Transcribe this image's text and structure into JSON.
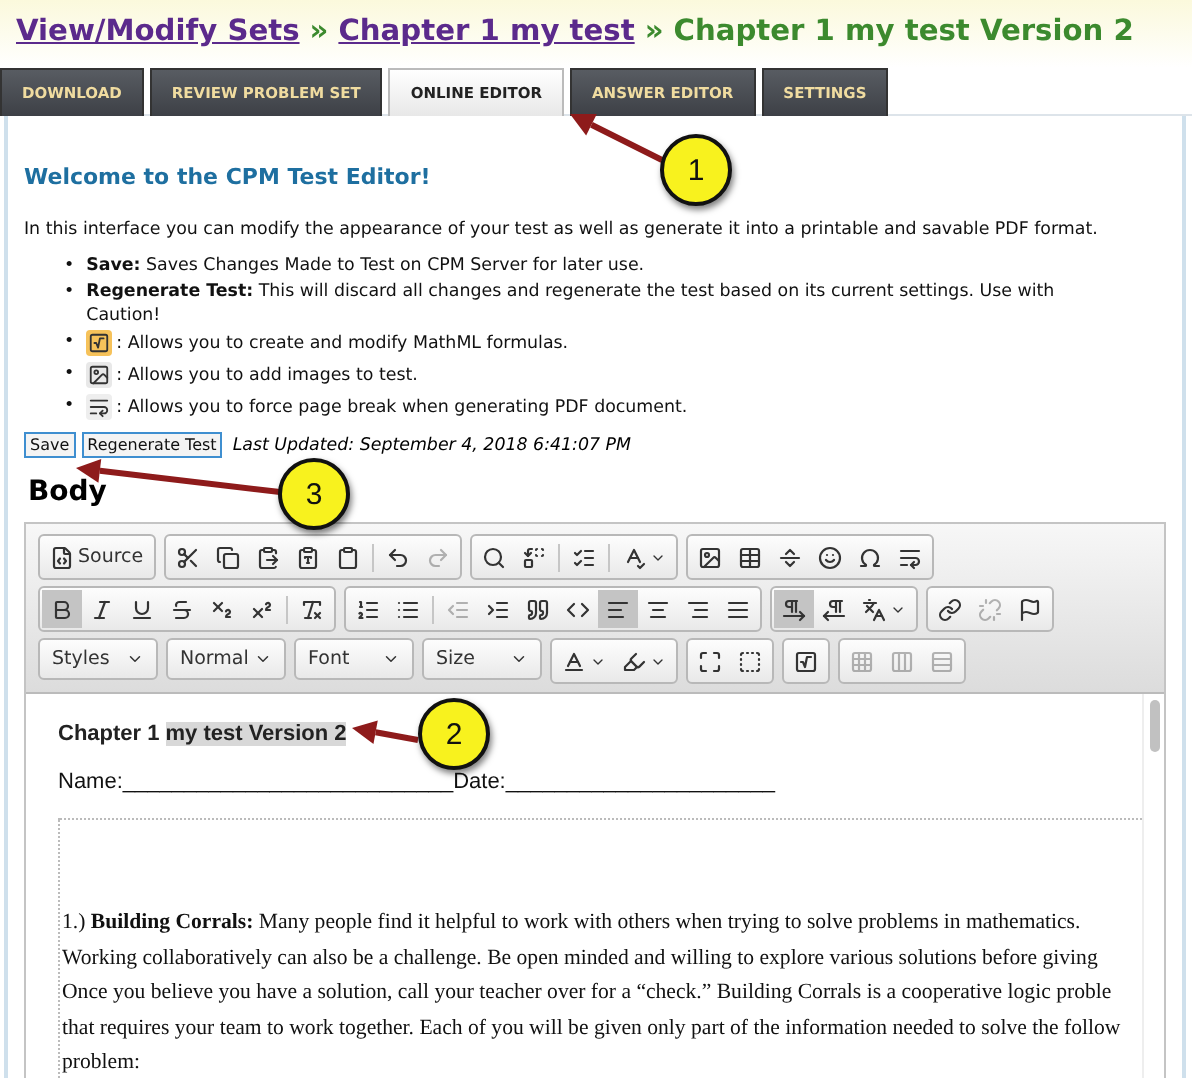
{
  "breadcrumb": [
    {
      "text": "View/Modify Sets",
      "kind": "link"
    },
    {
      "text": "»",
      "kind": "separator"
    },
    {
      "text": "Chapter 1 my test",
      "kind": "link"
    },
    {
      "text": "»",
      "kind": "separator"
    },
    {
      "text": "Chapter 1 my test Version 2",
      "kind": "current"
    }
  ],
  "tabs": [
    {
      "label": "DOWNLOAD",
      "selected": false
    },
    {
      "label": "REVIEW PROBLEM SET",
      "selected": false
    },
    {
      "label": "ONLINE EDITOR",
      "selected": true
    },
    {
      "label": "ANSWER EDITOR",
      "selected": false
    },
    {
      "label": "SETTINGS",
      "selected": false
    }
  ],
  "welcome": "Welcome to the CPM Test Editor!",
  "intro": "In this interface you can modify the appearance of your test as well as generate it into a printable and savable PDF format.",
  "bullets": [
    {
      "kind": "text",
      "marker": "•",
      "text": "**Save:** Saves Changes Made to Test on CPM Server for later use."
    },
    {
      "kind": "text",
      "marker": "•",
      "text": "**Regenerate Test:** This will discard all changes and regenerate the test based on its current settings. Use with Caution!"
    },
    {
      "kind": "formula",
      "marker": "•",
      "text": ": Allows you to create and modify MathML formulas."
    },
    {
      "kind": "image",
      "marker": "•",
      "text": ": Allows you to add images to test."
    },
    {
      "kind": "pagebreak",
      "marker": "•",
      "text": ": Allows you to force page break when generating PDF document."
    }
  ],
  "buttons": [
    "Save",
    "Regenerate Test"
  ],
  "last_updated": "Last Updated: September 4, 2018 6:41:07 PM",
  "body_heading": "Body",
  "toolbar": [
    [
      [
        {
          "kind": "button",
          "label": "Source",
          "active": false,
          "disabled": false
        }
      ],
      [
        {
          "kind": "button",
          "active": false,
          "disabled": false
        },
        {
          "kind": "button",
          "active": false,
          "disabled": false
        },
        {
          "kind": "button",
          "active": false,
          "disabled": false
        },
        {
          "kind": "button",
          "active": false,
          "disabled": false
        },
        {
          "kind": "button",
          "active": false,
          "disabled": false
        },
        {
          "kind": "separator"
        },
        {
          "kind": "button",
          "active": false,
          "disabled": false
        },
        {
          "kind": "button",
          "active": false,
          "disabled": true
        }
      ],
      [
        {
          "kind": "button",
          "active": false,
          "disabled": false
        },
        {
          "kind": "button",
          "active": false,
          "disabled": false
        },
        {
          "kind": "separator"
        },
        {
          "kind": "button",
          "active": false,
          "disabled": false
        },
        {
          "kind": "separator"
        },
        {
          "kind": "menu",
          "active": false,
          "disabled": false
        }
      ],
      [
        {
          "kind": "button",
          "active": false,
          "disabled": false
        },
        {
          "kind": "button",
          "active": false,
          "disabled": false
        },
        {
          "kind": "button",
          "active": false,
          "disabled": false
        },
        {
          "kind": "button",
          "active": false,
          "disabled": false
        },
        {
          "kind": "button",
          "active": false,
          "disabled": false
        },
        {
          "kind": "button",
          "active": false,
          "disabled": false
        }
      ]
    ],
    [
      [
        {
          "kind": "button",
          "active": true,
          "disabled": false
        },
        {
          "kind": "button",
          "active": false,
          "disabled": false
        },
        {
          "kind": "button",
          "active": false,
          "disabled": false
        },
        {
          "kind": "button",
          "active": false,
          "disabled": false
        },
        {
          "kind": "button",
          "active": false,
          "disabled": false
        },
        {
          "kind": "button",
          "active": false,
          "disabled": false
        },
        {
          "kind": "separator"
        },
        {
          "kind": "button",
          "active": false,
          "disabled": false
        }
      ],
      [
        {
          "kind": "button",
          "active": false,
          "disabled": false
        },
        {
          "kind": "button",
          "active": false,
          "disabled": false
        },
        {
          "kind": "separator"
        },
        {
          "kind": "button",
          "active": false,
          "disabled": true
        },
        {
          "kind": "button",
          "active": false,
          "disabled": false
        },
        {
          "kind": "button",
          "active": false,
          "disabled": false
        },
        {
          "kind": "button",
          "active": false,
          "disabled": false
        },
        {
          "kind": "button",
          "active": true,
          "disabled": false
        },
        {
          "kind": "button",
          "active": false,
          "disabled": false
        },
        {
          "kind": "button",
          "active": false,
          "disabled": false
        },
        {
          "kind": "button",
          "active": false,
          "disabled": false
        }
      ],
      [
        {
          "kind": "button",
          "active": true,
          "disabled": false
        },
        {
          "kind": "button",
          "active": false,
          "disabled": false
        },
        {
          "kind": "menu",
          "active": false,
          "disabled": false
        }
      ],
      [
        {
          "kind": "button",
          "active": false,
          "disabled": false
        },
        {
          "kind": "button",
          "active": false,
          "disabled": true
        },
        {
          "kind": "button",
          "active": false,
          "disabled": false
        }
      ]
    ],
    [
      [
        {
          "kind": "dropdown",
          "label": "Styles"
        }
      ],
      [
        {
          "kind": "dropdown",
          "label": "Normal"
        }
      ],
      [
        {
          "kind": "dropdown",
          "label": "Font"
        }
      ],
      [
        {
          "kind": "dropdown",
          "label": "Size"
        }
      ],
      [
        {
          "kind": "menu",
          "active": false,
          "disabled": false
        },
        {
          "kind": "menu",
          "active": false,
          "disabled": false
        }
      ],
      [
        {
          "kind": "button",
          "active": false,
          "disabled": false
        },
        {
          "kind": "button",
          "active": false,
          "disabled": false
        }
      ],
      [
        {
          "kind": "button",
          "active": false,
          "disabled": false
        }
      ],
      [
        {
          "kind": "button",
          "active": false,
          "disabled": true
        },
        {
          "kind": "button",
          "active": false,
          "disabled": true
        },
        {
          "kind": "button",
          "active": false,
          "disabled": true
        }
      ]
    ]
  ],
  "document": {
    "title_parts": [
      {
        "text": "Chapter 1",
        "selected": false
      },
      {
        "text": "my test Version 2",
        "selected": true
      }
    ],
    "name_line": "Name:___________________________Date:______________________",
    "paragraph_lines": [
      "1.) **Building Corrals:** Many people find it helpful to work with others when trying to solve problems in mathematics.",
      "Working collaboratively can also be a challenge.  Be open minded and willing to explore various solutions before giving",
      "Once you believe you have a solution, call your teacher over for a “check.” Building Corrals is a cooperative logic proble",
      "that requires your team to work together.  Each of you will be given only part of the information needed to solve the follow",
      "problem:"
    ]
  },
  "callouts": [
    "1",
    "2",
    "3"
  ]
}
